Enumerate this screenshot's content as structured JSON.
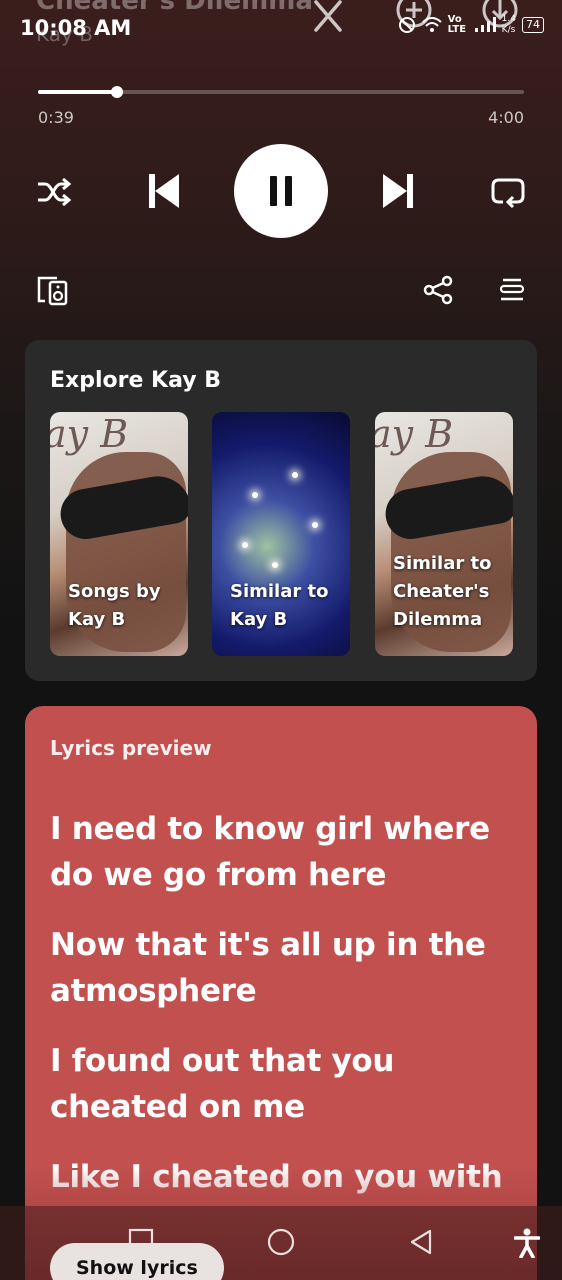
{
  "status_bar": {
    "time": "10:08 AM",
    "network": "Vo LTE",
    "data_speed_value": "1.4",
    "data_speed_unit": "K/s",
    "battery": "74"
  },
  "now_playing": {
    "title": "Cheater's Dilemma",
    "artist": "Kay B",
    "elapsed": "0:39",
    "duration": "4:00",
    "progress": 0.1625
  },
  "controls": {
    "shuffle": "shuffle-icon",
    "previous": "skip-previous-icon",
    "pause": "pause-icon",
    "next": "skip-next-icon",
    "repeat": "repeat-icon",
    "devices": "connect-device-icon",
    "share": "share-icon",
    "queue": "queue-icon"
  },
  "explore": {
    "title": "Explore Kay B",
    "tiles": [
      {
        "label": "Songs by Kay B"
      },
      {
        "label": "Similar to Kay B"
      },
      {
        "label": "Similar to Cheater's Dilemma"
      }
    ]
  },
  "lyrics": {
    "heading": "Lyrics preview",
    "lines": [
      "I need to know girl where do we go from here",
      "Now that it's all up in the atmosphere",
      "I found out that you cheated on me",
      "Like I cheated on you with"
    ],
    "button": "Show lyrics"
  },
  "colors": {
    "lyrics_card": "#c2504f",
    "explore_card": "#2a2a2a",
    "background": "#121212"
  }
}
